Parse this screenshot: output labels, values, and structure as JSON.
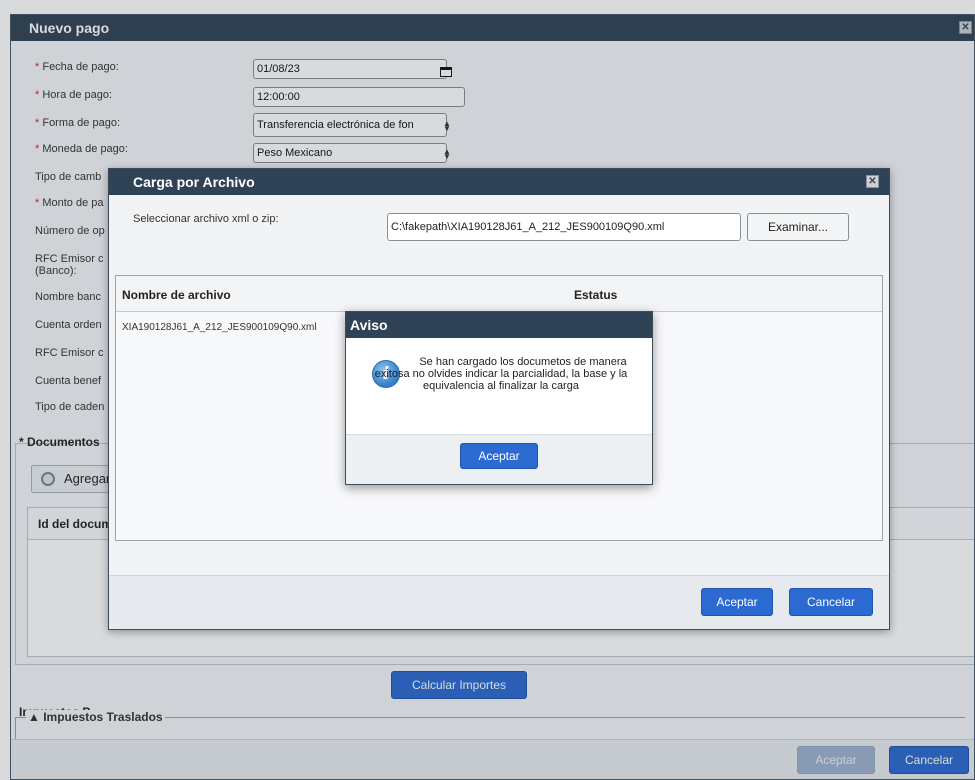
{
  "outer": {
    "title": "Nuevo pago",
    "close": "✕",
    "fields": {
      "fecha_label": "Fecha de pago:",
      "fecha_value": "01/08/23",
      "hora_label": "Hora de pago:",
      "hora_value": "12:00:00",
      "forma_label": "Forma de pago:",
      "forma_value": "Transferencia electrónica de fon",
      "moneda_label": "Moneda de pago:",
      "moneda_value": "Peso Mexicano",
      "tipo_cambio_label": "Tipo de camb",
      "monto_label": "Monto de pa",
      "numero_label": "Número de op",
      "rfc_emisor_label_1": "RFC Emisor c",
      "rfc_emisor_label_2": "(Banco):",
      "nombre_banco_label": "Nombre banc",
      "cuenta_ordenante_label": "Cuenta orden",
      "rfc_emisor_2_label": "RFC Emisor c",
      "cuenta_benef_label": "Cuenta benef",
      "tipo_cadena_label": "Tipo de caden"
    },
    "required_mark": "*",
    "documentos_legend": "* Documentos",
    "agregar": "Agregar",
    "docs_header": "Id del docum",
    "calcular": "Calcular Importes",
    "impuestos_legend": "Impuestos P",
    "traslados_legend": "▲ Impuestos Traslados",
    "aceptar": "Aceptar",
    "cancelar": "Cancelar"
  },
  "carga": {
    "title": "Carga por Archivo",
    "close": "✕",
    "select_label": "Seleccionar archivo xml o zip:",
    "file_path": "C:\\fakepath\\XIA190128J61_A_212_JES900109Q90.xml",
    "examinar": "Examinar...",
    "col_nombre": "Nombre de archivo",
    "col_estatus": "Estatus",
    "row_nombre": "XIA190128J61_A_212_JES900109Q90.xml",
    "aceptar": "Aceptar",
    "cancelar": "Cancelar"
  },
  "aviso": {
    "title": "Aviso",
    "icon": "i",
    "message": "Se han cargado los documetos de manera exitosa no olvides indicar la parcialidad, la base y la equivalencia al finalizar la carga",
    "aceptar": "Aceptar"
  }
}
